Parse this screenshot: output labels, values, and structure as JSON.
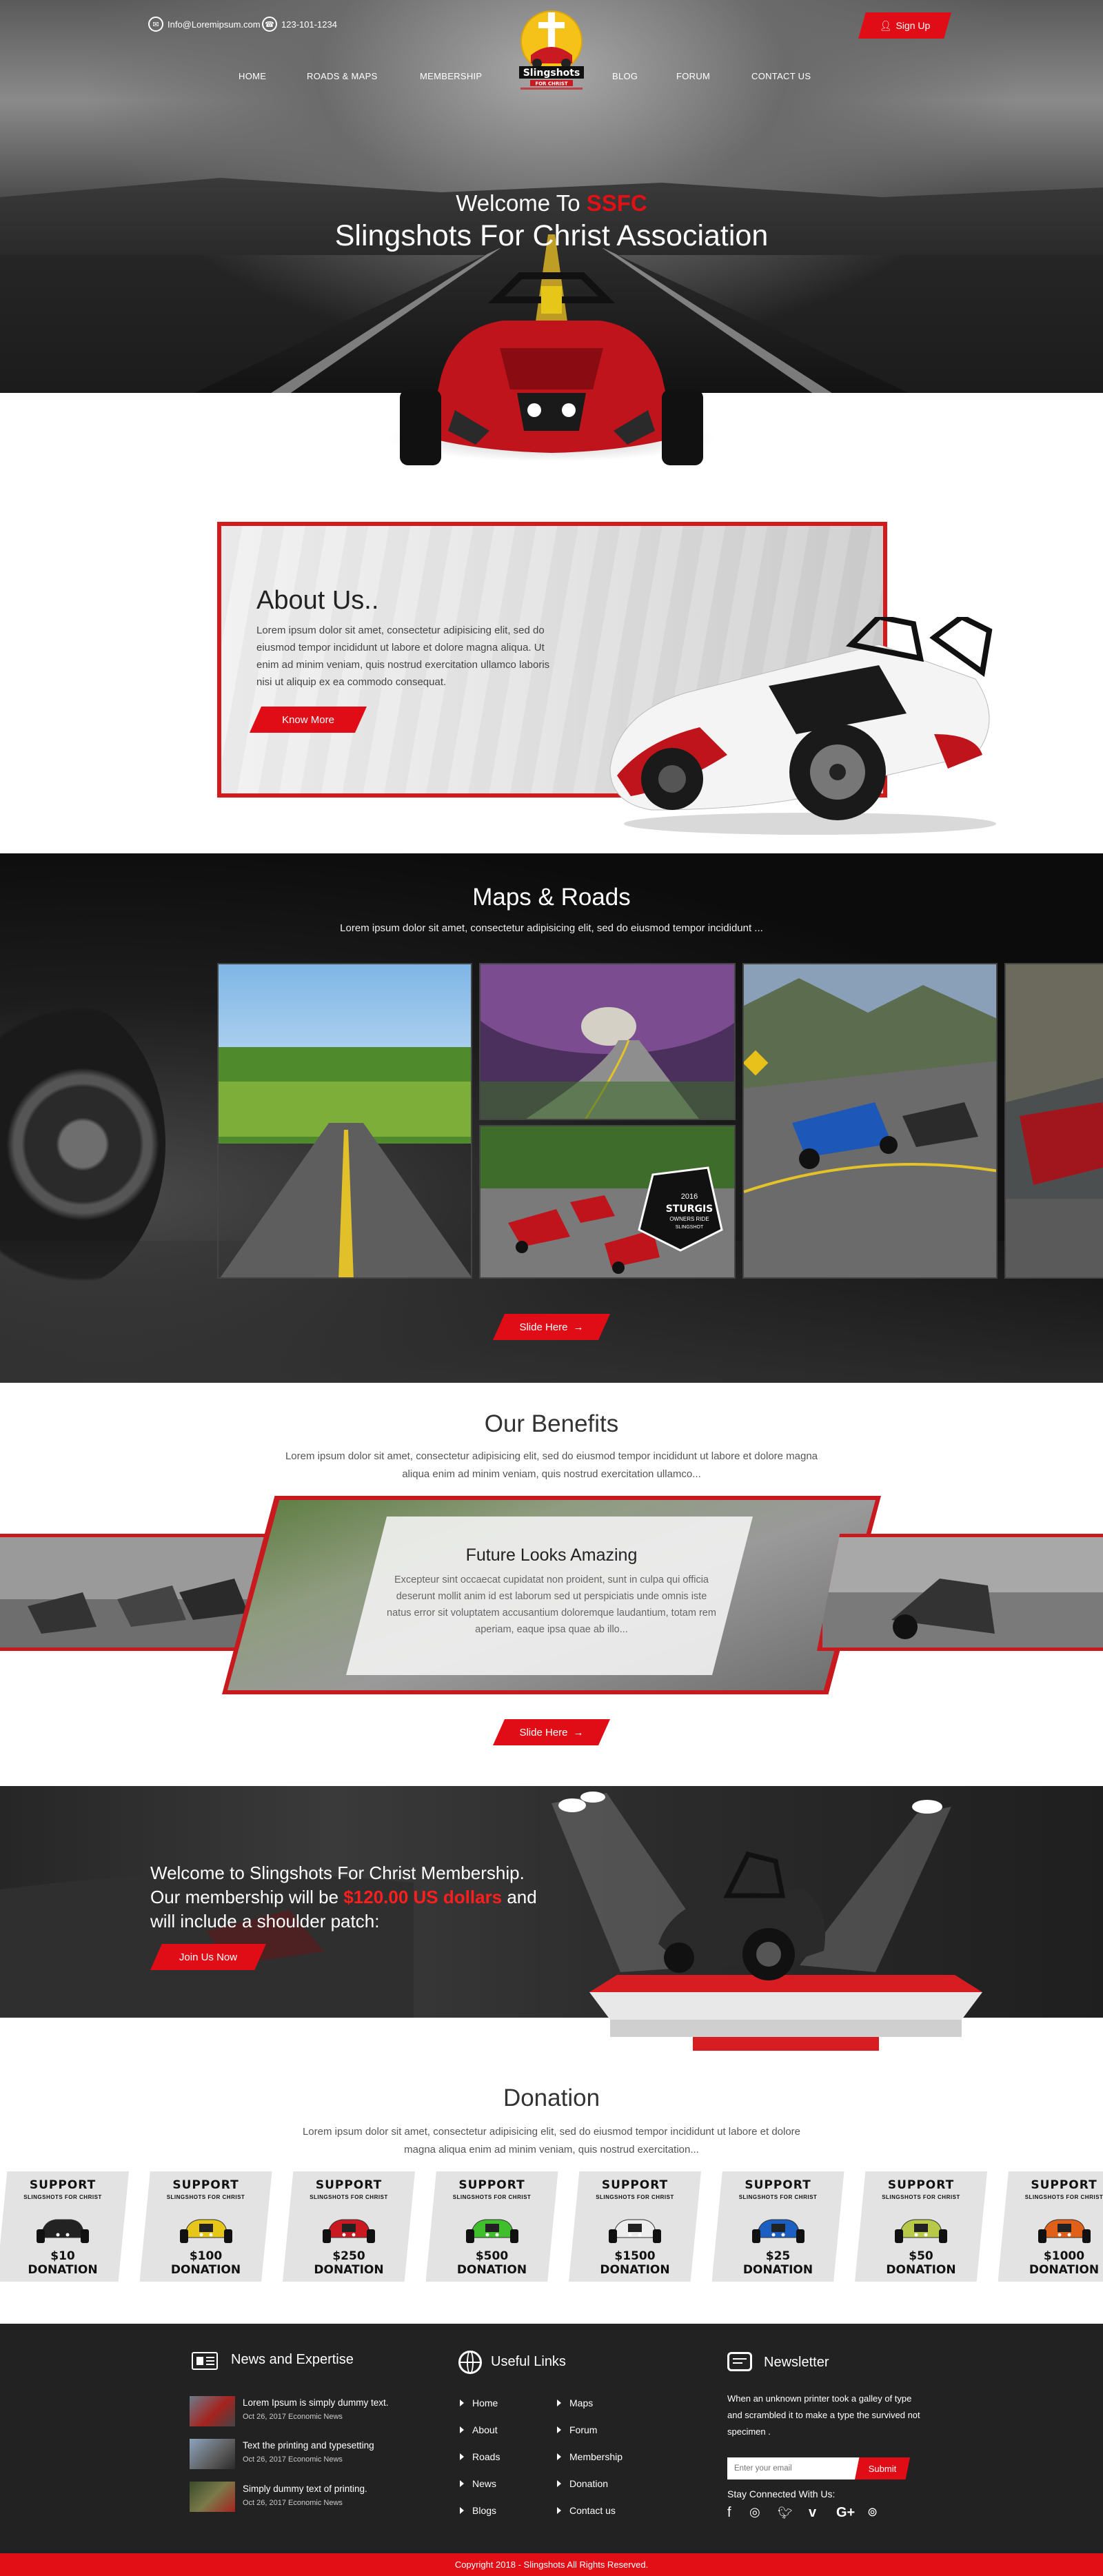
{
  "topbar": {
    "email": "Info@Loremipsum.com",
    "phone": "123-101-1234",
    "signup_label": "Sign Up"
  },
  "nav": {
    "items": [
      "HOME",
      "ROADS & MAPS",
      "MEMBERSHIP",
      "BLOG",
      "FORUM",
      "CONTACT US"
    ]
  },
  "logo": {
    "line1": "Slingshots",
    "line2": "FOR CHRIST"
  },
  "hero": {
    "welcome": "Welcome To ",
    "welcome_accent": "SSFC",
    "title": "Slingshots For Christ Association"
  },
  "about": {
    "title": "About Us..",
    "text": "Lorem ipsum dolor sit amet, consectetur adipisicing elit, sed do eiusmod tempor incididunt ut labore et dolore magna aliqua. Ut enim ad minim veniam, quis nostrud exercitation ullamco laboris nisi ut aliquip ex ea commodo consequat.",
    "button": "Know More"
  },
  "maps": {
    "title": "Maps & Roads",
    "subtitle": "Lorem ipsum dolor sit amet, consectetur adipisicing elit, sed do eiusmod tempor incididunt ...",
    "button": "Slide Here",
    "badge_year": "2016",
    "badge_line1": "STURGIS",
    "badge_line2": "OWNERS RIDE",
    "badge_line3": "SLINGSHOT"
  },
  "benefits": {
    "title": "Our Benefits",
    "subtitle": "Lorem ipsum dolor sit amet, consectetur adipisicing elit, sed do eiusmod tempor incididunt ut labore et dolore magna aliqua enim ad minim veniam, quis nostrud exercitation ullamco...",
    "card_title": "Future Looks Amazing",
    "card_text": "Excepteur sint occaecat cupidatat non proident, sunt in culpa qui officia deserunt mollit anim id est laborum sed ut perspiciatis unde omnis iste natus error sit voluptatem accusantium doloremque laudantium, totam rem aperiam, eaque ipsa quae ab illo...",
    "button": "Slide Here"
  },
  "membership": {
    "line1": "Welcome to Slingshots For Christ Membership.",
    "line2_pre": "Our membership will be ",
    "line2_price": "$120.00 US dollars",
    "line2_post": " and",
    "line3": "will include a shoulder patch:",
    "button": "Join Us Now"
  },
  "donation": {
    "title": "Donation",
    "subtitle": "Lorem ipsum dolor sit amet, consectetur adipisicing elit, sed do eiusmod tempor incididunt ut labore et dolore magna aliqua enim ad minim veniam, quis nostrud exercitation...",
    "cards": [
      {
        "top": "SUPPORT",
        "sub": "SLINGSHOTS FOR CHRIST",
        "amount": "$10",
        "label": "DONATION",
        "car_color": "#222222"
      },
      {
        "top": "SUPPORT",
        "sub": "SLINGSHOTS FOR CHRIST",
        "amount": "$100",
        "label": "DONATION",
        "car_color": "#e6c619"
      },
      {
        "top": "SUPPORT",
        "sub": "SLINGSHOTS FOR CHRIST",
        "amount": "$250",
        "label": "DONATION",
        "car_color": "#c81a20"
      },
      {
        "top": "SUPPORT",
        "sub": "SLINGSHOTS FOR CHRIST",
        "amount": "$500",
        "label": "DONATION",
        "car_color": "#3fbf2b"
      },
      {
        "top": "SUPPORT",
        "sub": "SLINGSHOTS FOR CHRIST",
        "amount": "$1500",
        "label": "DONATION",
        "car_color": "#eeeeee"
      },
      {
        "top": "SUPPORT",
        "sub": "SLINGSHOTS FOR CHRIST",
        "amount": "$25",
        "label": "DONATION",
        "car_color": "#1b5fc2"
      },
      {
        "top": "SUPPORT",
        "sub": "SLINGSHOTS FOR CHRIST",
        "amount": "$50",
        "label": "DONATION",
        "car_color": "#b8c94a"
      },
      {
        "top": "SUPPORT",
        "sub": "SLINGSHOTS FOR CHRIST",
        "amount": "$1000",
        "label": "DONATION",
        "car_color": "#e0601a"
      }
    ]
  },
  "footer": {
    "news_title": "News and Expertise",
    "news": [
      {
        "title": "Lorem Ipsum is simply dummy text.",
        "date": "Oct 26, 2017 Economic News"
      },
      {
        "title": "Text  the printing and typesetting",
        "date": "Oct 26, 2017 Economic News"
      },
      {
        "title": "Simply dummy text of printing.",
        "date": "Oct 26, 2017 Economic News"
      }
    ],
    "links_title": "Useful Links",
    "links_col1": [
      "Home",
      "About",
      "Roads",
      "News",
      "Blogs"
    ],
    "links_col2": [
      "Maps",
      "Forum",
      "Membership",
      "Donation",
      "Contact us"
    ],
    "newsletter_title": "Newsletter",
    "newsletter_text": "When an unknown printer took a galley of type and scrambled it to make a type the survived not specimen .",
    "email_placeholder": "Enter your email",
    "submit_label": "Submit",
    "stay_connected": "Stay Connected With Us:",
    "social_icons": [
      "facebook-icon",
      "instagram-icon",
      "twitter-icon",
      "vimeo-icon",
      "google-plus-icon",
      "rss-icon"
    ],
    "copyright": "Copyright 2018 - Slingshots All Rights Reserved."
  },
  "colors": {
    "accent": "#e00d16",
    "dark": "#222222"
  }
}
